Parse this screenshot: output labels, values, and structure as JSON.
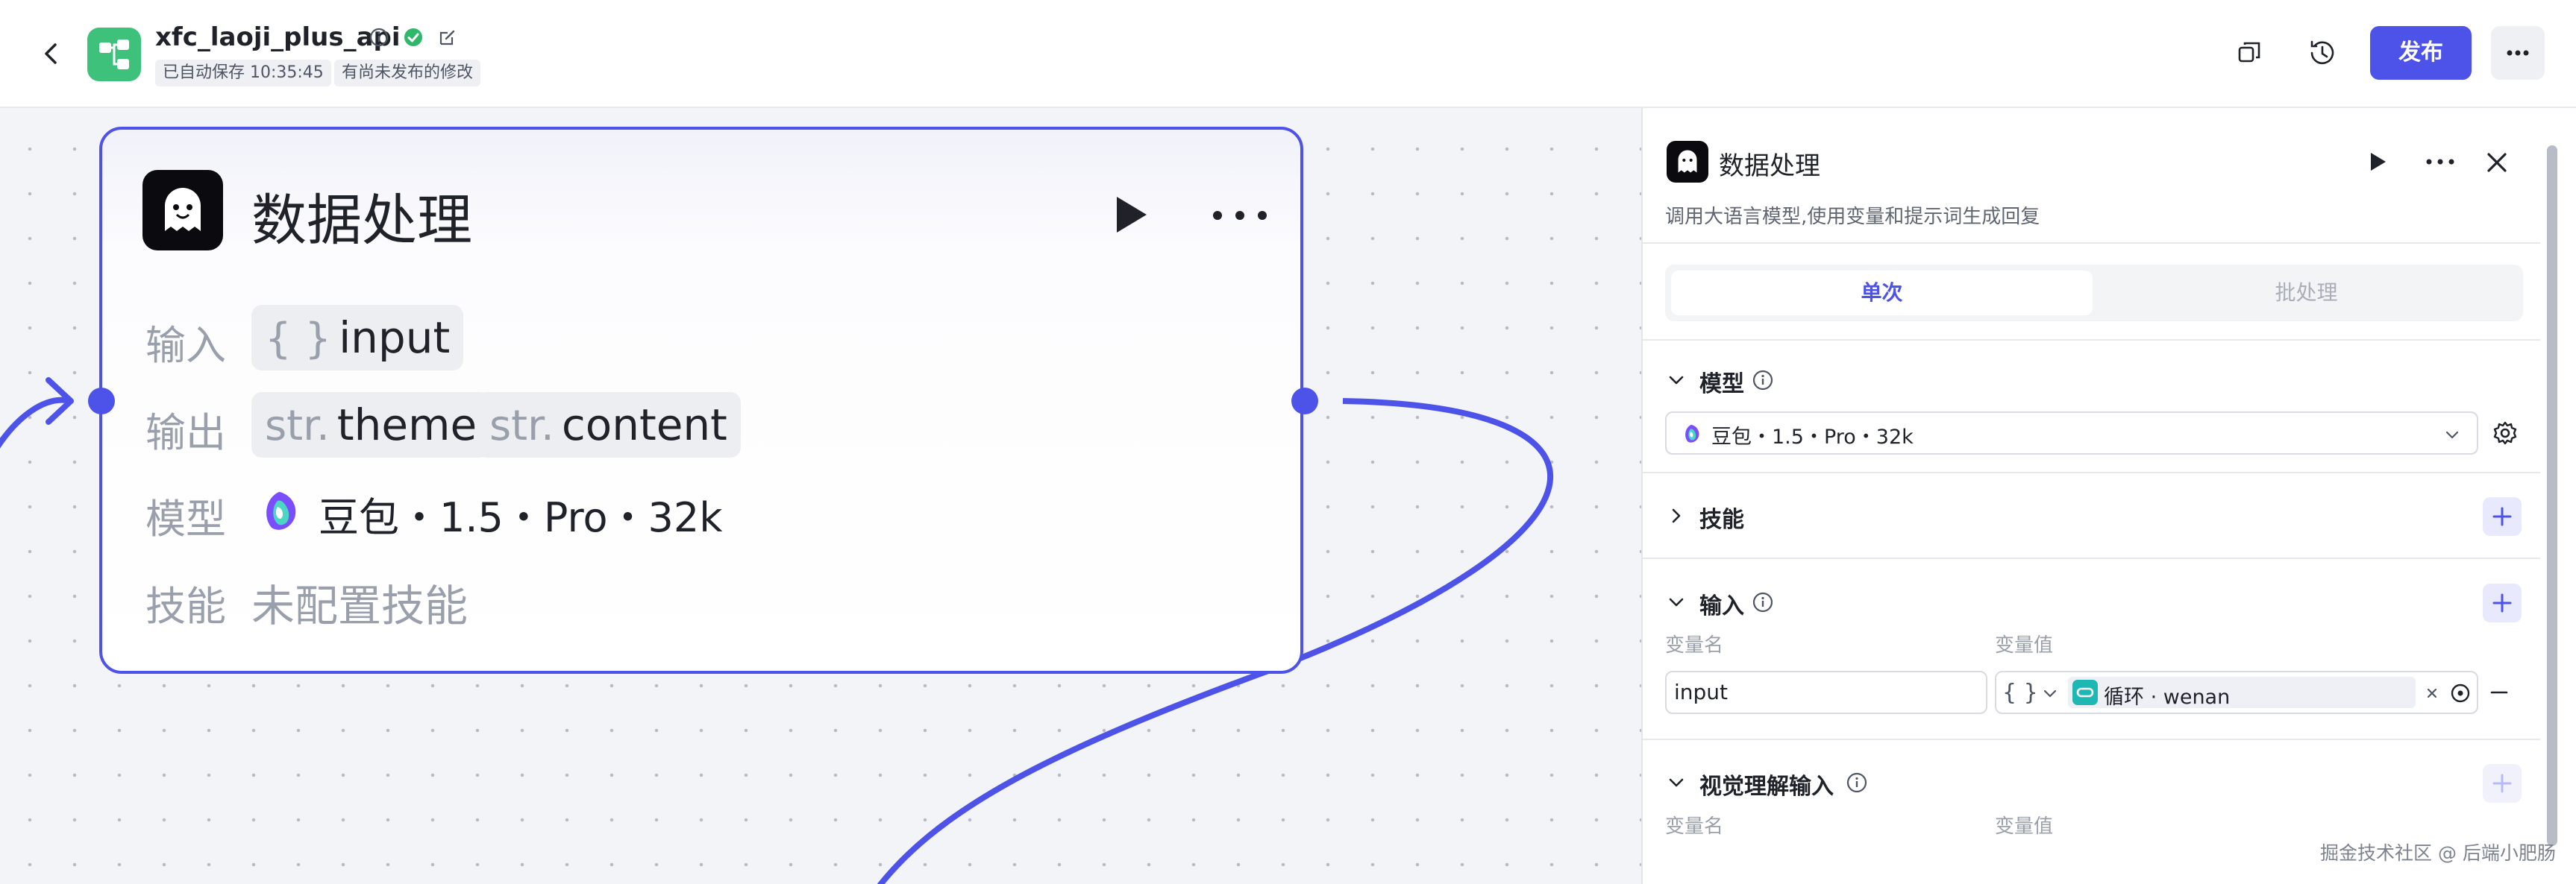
{
  "header": {
    "app_name": "xfc_laoji_plus_api",
    "autosave": "已自动保存 10:35:45",
    "unpublished": "有尚未发布的修改",
    "publish_label": "发布"
  },
  "node": {
    "title": "数据处理",
    "input_label": "输入",
    "input_var": "input",
    "input_prefix": "{ }",
    "output_label": "输出",
    "outputs": [
      {
        "prefix": "str.",
        "name": "theme"
      },
      {
        "prefix": "str.",
        "name": "content"
      }
    ],
    "model_label": "模型",
    "model_value": "豆包・1.5・Pro・32k",
    "skill_label": "技能",
    "skill_value": "未配置技能"
  },
  "panel": {
    "title": "数据处理",
    "description": "调用大语言模型,使用变量和提示词生成回复",
    "tabs": [
      "单次",
      "批处理"
    ],
    "model_section": {
      "title": "模型",
      "selected": "豆包・1.5・Pro・32k"
    },
    "skill_section": {
      "title": "技能"
    },
    "input_section": {
      "title": "输入",
      "col_name": "变量名",
      "col_value": "变量值",
      "var_name": "input",
      "ref_prefix": "{ }",
      "ref_text": "循环 · wenan"
    },
    "vision_section": {
      "title": "视觉理解输入",
      "col_name": "变量名",
      "col_value": "变量值"
    }
  },
  "watermark": "掘金技术社区 @ 后端小肥肠",
  "colors": {
    "accent": "#4d53e8",
    "app_icon": "#3ec27b",
    "loop_icon": "#1fb7b3",
    "canvas_bg": "#f3f4f8"
  }
}
